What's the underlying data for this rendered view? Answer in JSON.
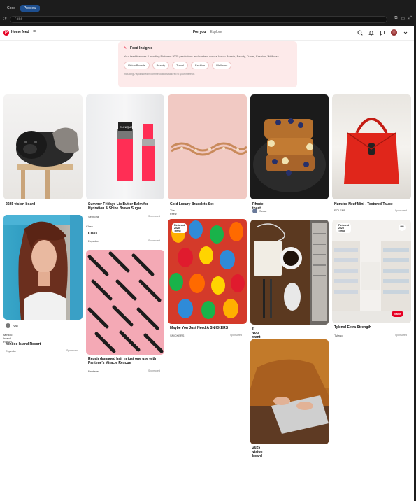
{
  "browser": {
    "tabs": [
      {
        "label": "Code"
      },
      {
        "label": "Preview"
      }
    ],
    "url": "/ ###"
  },
  "header": {
    "home_feed": "Home feed",
    "tab_for_you": "For you",
    "tab_explore": "Explore"
  },
  "insights": {
    "title": "Feed Insights",
    "body": "Your feed features 2 trending Pinterest 2025 predictions and content across Vision Boards, Beauty, Travel, Fashion, Wellness.",
    "chips": [
      "Vision Boards",
      "Beauty",
      "Travel",
      "Fashion",
      "Wellness"
    ],
    "footer": "Including 7 sponsored recommendations tailored to your interests"
  },
  "pins": {
    "pug": {
      "title": "2025 vision board"
    },
    "lipstick": {
      "title": "Summer Fridays Lip Butter Balm for Hydration & Shine Brown Sugar",
      "source": "Sephora",
      "sponsored": "Sponsored"
    },
    "bracelet": {
      "title": "Gold Luxury Bracelets Set",
      "source": "The Feelz"
    },
    "toast": {
      "title": "Rhode toast",
      "user": "Scout"
    },
    "bag": {
      "title": "Numéro Neuf Mini - Textured Taupe",
      "source": "POLENE",
      "sponsored": "Sponsored"
    },
    "woman": {
      "user": "ryan"
    },
    "island": {
      "alt": "Miniloc Island Resort",
      "title": "Miniloc Island Resort",
      "source": "Expedia",
      "sponsored": "Sponsored"
    },
    "class": {
      "alt": "Class",
      "title": "Class",
      "source": "Expedia",
      "sponsored": "Sponsored"
    },
    "brushes": {
      "title": "Repair damaged hair in just one use with Pantene's Miracle Rescue",
      "source": "Pantene",
      "sponsored": "Sponsored"
    },
    "gummies": {
      "badge": "Pinterest 2025 Trend",
      "title": "Maybe You Just Need A SNICKERS",
      "source": "SNICKERS",
      "sponsored": "Sponsored"
    },
    "coffee": {
      "title": "If you want it, work for it"
    },
    "pharmacy": {
      "badge": "Pinterest 2025 Trend",
      "save": "Save",
      "more": "•••",
      "title": "Tylenol Extra Strength",
      "source": "Tylenol",
      "sponsored": "Sponsored"
    },
    "sweater": {
      "title": "2025 vision board"
    }
  }
}
